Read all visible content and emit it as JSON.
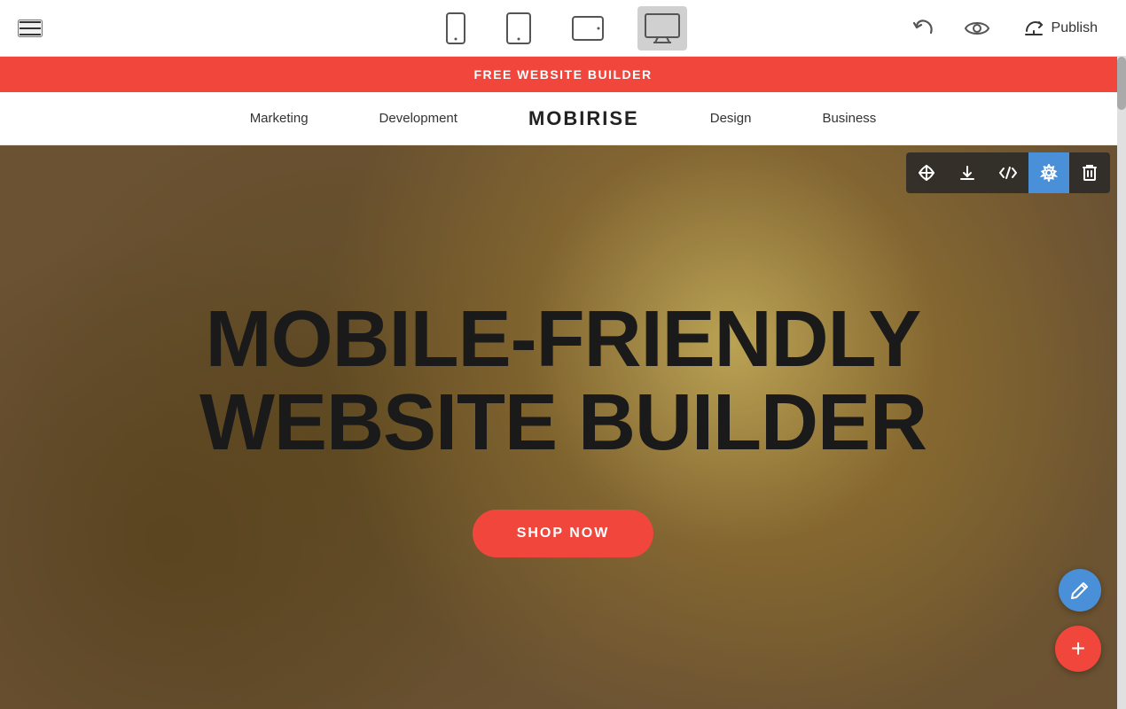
{
  "toolbar": {
    "hamburger_label": "menu",
    "devices": [
      {
        "id": "mobile",
        "label": "Mobile view",
        "active": false
      },
      {
        "id": "tablet",
        "label": "Tablet view",
        "active": false
      },
      {
        "id": "tablet-landscape",
        "label": "Tablet landscape view",
        "active": false
      },
      {
        "id": "desktop",
        "label": "Desktop view",
        "active": true
      }
    ],
    "undo_label": "Undo",
    "preview_label": "Preview",
    "publish_label": "Publish"
  },
  "promo_banner": {
    "text": "FREE WEBSITE BUILDER"
  },
  "navbar": {
    "brand": "MOBIRISE",
    "links": [
      "Marketing",
      "Development",
      "Design",
      "Business"
    ]
  },
  "hero": {
    "title_line1": "MOBILE-FRIENDLY",
    "title_line2": "WEBSITE BUILDER",
    "cta_label": "SHOP NOW"
  },
  "section_toolbar": {
    "buttons": [
      {
        "id": "move",
        "label": "Move section"
      },
      {
        "id": "download",
        "label": "Download section"
      },
      {
        "id": "code",
        "label": "Edit code"
      },
      {
        "id": "settings",
        "label": "Section settings",
        "active": true
      },
      {
        "id": "delete",
        "label": "Delete section"
      }
    ]
  },
  "fab": {
    "pencil_label": "Edit",
    "add_label": "Add section"
  }
}
